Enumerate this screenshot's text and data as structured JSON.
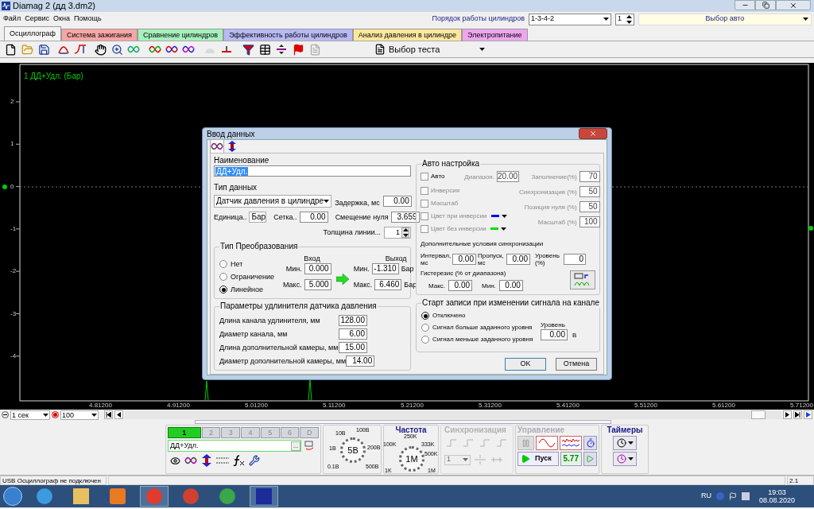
{
  "window": {
    "title": "Diamag 2 (дд 3.dm2)"
  },
  "menu": [
    "Файл",
    "Сервис",
    "Окна",
    "Помощь"
  ],
  "cylinder_order": {
    "label": "Порядок работы цилиндров",
    "value": "1-3-4-2",
    "spin": "1"
  },
  "car_select": "Выбор авто",
  "tabs": [
    {
      "label": "Осциллограф",
      "selected": true,
      "color": "#f4f4f4"
    },
    {
      "label": "Система зажигания",
      "selected": false,
      "color": "#f6a6a6"
    },
    {
      "label": "Сравнение цилиндров",
      "selected": false,
      "color": "#a6f0bd"
    },
    {
      "label": "Эффективность работы цилиндров",
      "selected": false,
      "color": "#b8b8f4"
    },
    {
      "label": "Анализ давления в цилиндре",
      "selected": false,
      "color": "#fbe79e"
    },
    {
      "label": "Электропитание",
      "selected": false,
      "color": "#eea6ee"
    }
  ],
  "test_select": "Выбор теста",
  "plot": {
    "channel_label": "1 ДД+Удл. (Бар)",
    "y_labels": [
      "2",
      "1",
      "0",
      "-1",
      "-2",
      "-3",
      "-4"
    ],
    "x_labels": [
      "4.81200",
      "4.91200",
      "5.01200",
      "5.11200",
      "5.21200",
      "5.31200",
      "5.41200",
      "5.51200",
      "5.61200",
      "5.71200"
    ]
  },
  "timebase": {
    "value": "1 сек",
    "zoom": "100"
  },
  "channels": [
    {
      "label": "1",
      "selected": true
    },
    {
      "label": "2",
      "selected": false
    },
    {
      "label": "3",
      "selected": false
    },
    {
      "label": "4",
      "selected": false
    },
    {
      "label": "5",
      "selected": false
    },
    {
      "label": "6",
      "selected": false
    },
    {
      "label": "D",
      "selected": false
    }
  ],
  "channel_name": "ДД+Удл.",
  "channel_more": "...",
  "volt_knob": {
    "value": "5В",
    "labels": [
      "10В",
      "100В",
      "1В",
      "200В",
      "0.1В",
      "500В"
    ]
  },
  "freq_knob": {
    "title": "Частота",
    "value": "1М",
    "labels": [
      "250K",
      "100K",
      "333K",
      "500K",
      "1K",
      "1M"
    ]
  },
  "sync": {
    "title": "Синхронизация",
    "value": "1"
  },
  "control": {
    "title": "Управление",
    "start": "Пуск",
    "reading": "5.77"
  },
  "timers": {
    "title": "Таймеры"
  },
  "status_bar": {
    "text": "USB Осциллограф не подключен",
    "version": "2.1"
  },
  "taskbar": {
    "lang": "RU",
    "time": "19:03",
    "date": "08.08.2020"
  },
  "dialog": {
    "title": "Ввод данных",
    "name": {
      "label": "Наименование",
      "value": "ДД+Удл."
    },
    "data_type": {
      "label": "Тип данных",
      "value": "Датчик давления в цилиндре"
    },
    "delay": {
      "label": "Задержка, мс",
      "value": "0.00"
    },
    "unit": {
      "label": "Единица..",
      "value": "Бар"
    },
    "grid": {
      "label": "Сетка..",
      "value": "0.00"
    },
    "zero_offset": {
      "label": "Смещение нуля",
      "value": "3.659"
    },
    "line_width": {
      "label": "Толщина линии...",
      "value": "1"
    },
    "conversion": {
      "title": "Тип Преобразования",
      "options": [
        {
          "label": "Нет",
          "selected": false
        },
        {
          "label": "Ограничение",
          "selected": false
        },
        {
          "label": "Линейное",
          "selected": true
        }
      ],
      "input": {
        "header": "Вход",
        "min_label": "Мин.",
        "min": "0.000",
        "max_label": "Макс.",
        "max": "5.000"
      },
      "output": {
        "header": "Выход",
        "min_label": "Мин.",
        "min": "-1.310",
        "max_label": "Макс.",
        "max": "6.460",
        "min_unit": "Бар",
        "max_unit": "Бар"
      }
    },
    "extender": {
      "title": "Параметры удлинителя датчика давления",
      "rows": [
        {
          "label": "Длина канала удлинителя, мм",
          "value": "128.00"
        },
        {
          "label": "Диаметр канала, мм",
          "value": "6.00"
        },
        {
          "label": "Длина дополнительной камеры, мм",
          "value": "15.00"
        },
        {
          "label": "Диаметр дополнительной камеры, мм",
          "value": "14.00"
        }
      ]
    },
    "auto": {
      "title": "Авто настройка",
      "checks": [
        {
          "label": "Авто",
          "checked": false,
          "disabled": false
        },
        {
          "label": "Инверсия",
          "checked": false,
          "disabled": true
        },
        {
          "label": "Масштаб",
          "checked": false,
          "disabled": true
        },
        {
          "label": "Цвет при инверсии",
          "checked": false,
          "disabled": true,
          "color": "#0000ff"
        },
        {
          "label": "Цвет без инверсии",
          "checked": false,
          "disabled": true,
          "color": "#00e000"
        }
      ],
      "range": {
        "label": "Диапазон.",
        "value": "20.00"
      },
      "params": [
        {
          "label": "Заполнение(%)",
          "value": "70"
        },
        {
          "label": "Синхронизация (%)",
          "value": "50"
        },
        {
          "label": "Позиция нуля (%)",
          "value": "50"
        },
        {
          "label": "Масштаб (%)",
          "value": "100"
        }
      ]
    },
    "sync_extra": {
      "title": "Дополнительные условия синхронизации",
      "interval": {
        "label": "Интервал, мс",
        "value": "0.00"
      },
      "skip": {
        "label": "Пропуск, мс",
        "value": "0.00"
      },
      "level": {
        "label": "Уровень (%)",
        "value": "0"
      },
      "hysteresis": "Гистерезис (% от диапазона)",
      "max": {
        "label": "Макс.",
        "value": "0.00"
      },
      "min": {
        "label": "Мин.",
        "value": "0.00"
      }
    },
    "record": {
      "title": "Старт записи при изменении сигнала на канале",
      "options": [
        {
          "label": "Отключено",
          "selected": true
        },
        {
          "label": "Сигнал больше заданного уровня",
          "selected": false
        },
        {
          "label": "Сигнал меньше заданного уровня",
          "selected": false
        }
      ],
      "level_label": "Уровень",
      "level": "0.00",
      "unit": "В"
    },
    "buttons": [
      "OK",
      "Отмена"
    ]
  }
}
